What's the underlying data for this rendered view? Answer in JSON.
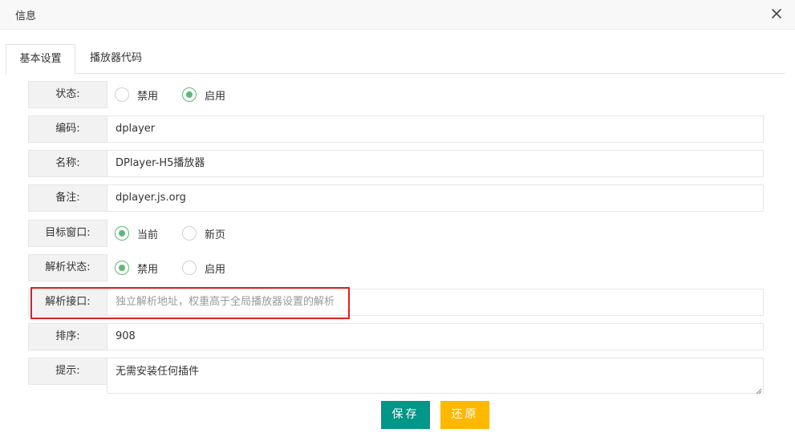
{
  "dialog": {
    "title": "信息",
    "close_icon": "close-icon"
  },
  "tabs": [
    {
      "label": "基本设置",
      "active": true
    },
    {
      "label": "播放器代码",
      "active": false
    }
  ],
  "form": {
    "status": {
      "label": "状态:",
      "options": [
        "禁用",
        "启用"
      ],
      "selected": "启用"
    },
    "code": {
      "label": "编码:",
      "value": "dplayer"
    },
    "name": {
      "label": "名称:",
      "value": "DPlayer-H5播放器"
    },
    "remark": {
      "label": "备注:",
      "value": "dplayer.js.org"
    },
    "target": {
      "label": "目标窗口:",
      "options": [
        "当前",
        "新页"
      ],
      "selected": "当前"
    },
    "parse_status": {
      "label": "解析状态:",
      "options": [
        "禁用",
        "启用"
      ],
      "selected": "禁用"
    },
    "parse_api": {
      "label": "解析接口:",
      "value": "",
      "placeholder": "独立解析地址，权重高于全局播放器设置的解析"
    },
    "sort": {
      "label": "排序:",
      "value": "908"
    },
    "tip": {
      "label": "提示:",
      "value": "无需安装任何插件"
    }
  },
  "buttons": {
    "save": "保存",
    "reset": "还原"
  },
  "colors": {
    "radio_on": "#5fb878",
    "save": "#009688",
    "reset": "#ffb800",
    "highlight": "#e02020"
  }
}
